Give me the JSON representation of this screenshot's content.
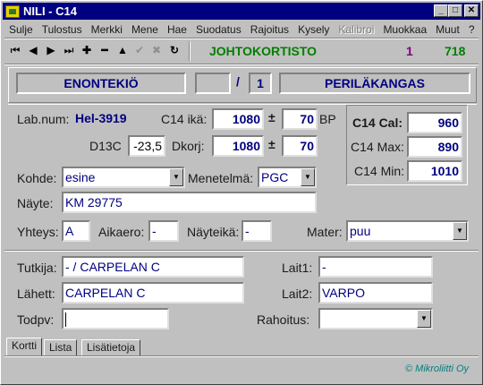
{
  "window": {
    "title": "NILI - C14"
  },
  "menu": [
    "Sulje",
    "Tulostus",
    "Merkki",
    "Mene",
    "Hae",
    "Suodatus",
    "Rajoitus",
    "Kysely",
    "Kalibroi",
    "Muokkaa",
    "Muut",
    "?"
  ],
  "toolbar": {
    "title": "JOHTOKORTISTO",
    "record_index": "1",
    "record_count": "718"
  },
  "header": {
    "municipality": "ENONTEKIÖ",
    "slash": "/",
    "number": "1",
    "site": "PERILÄKANGAS"
  },
  "lab": {
    "labnum_label": "Lab.num:",
    "labnum_value": "Hel-3919",
    "c14age_label": "C14 ikä:",
    "c14age_value": "1080",
    "c14age_err": "70",
    "pm": "±",
    "bp": "BP",
    "d13c_label": "D13C",
    "d13c_value": "-23,5",
    "dkorj_label": "Dkorj:",
    "dkorj_value": "1080",
    "dkorj_err": "70"
  },
  "cal": {
    "cal_label": "C14 Cal:",
    "cal_value": "960",
    "max_label": "C14 Max:",
    "max_value": "890",
    "min_label": "C14 Min:",
    "min_value": "1010"
  },
  "sample": {
    "kohde_label": "Kohde:",
    "kohde_value": "esine",
    "menetelma_label": "Menetelmä:",
    "menetelma_value": "PGC",
    "nayte_label": "Näyte:",
    "nayte_value": "KM 29775",
    "yhteys_label": "Yhteys:",
    "yhteys_value": "A",
    "aikaero_label": "Aikaero:",
    "aikaero_value": "-",
    "nayteika_label": "Näyteikä:",
    "nayteika_value": "-",
    "mater_label": "Mater:",
    "mater_value": "puu"
  },
  "people": {
    "tutkija_label": "Tutkija:",
    "tutkija_value": "- / CARPELAN C",
    "lahett_label": "Lähett:",
    "lahett_value": "CARPELAN C",
    "todpv_label": "Todpv:",
    "todpv_value": "",
    "lait1_label": "Lait1:",
    "lait1_value": "-",
    "lait2_label": "Lait2:",
    "lait2_value": "VARPO",
    "rahoitus_label": "Rahoitus:",
    "rahoitus_value": ""
  },
  "tabs": [
    "Kortti",
    "Lista",
    "Lisätietoja"
  ],
  "footer": "© Mikroliitti Oy",
  "colors": {
    "titlebar": "#000080",
    "value": "#000080",
    "title_green": "#008000",
    "record_purple": "#800080"
  }
}
